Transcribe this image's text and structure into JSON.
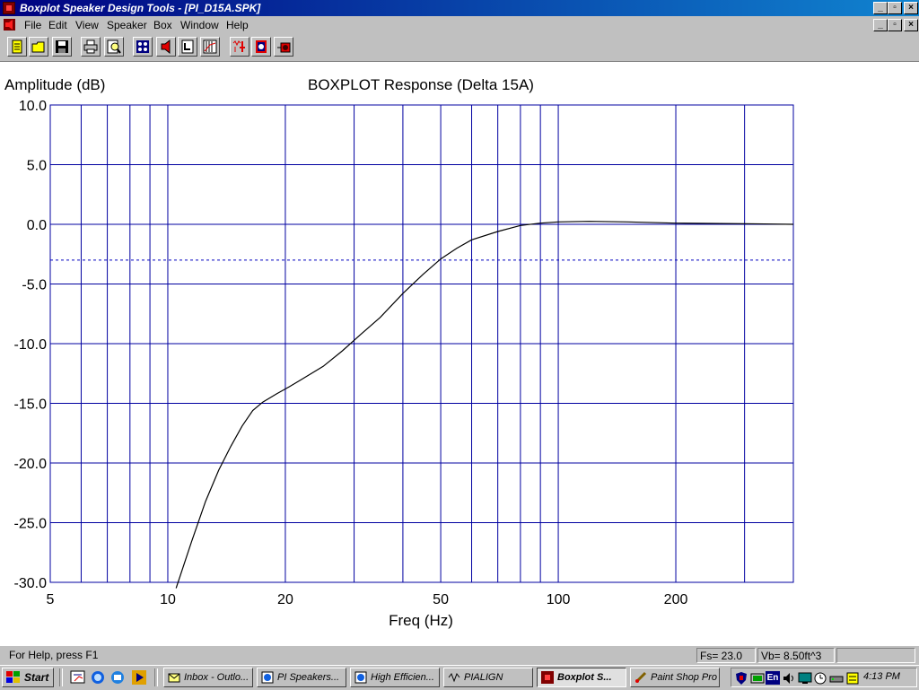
{
  "window": {
    "title": "Boxplot Speaker Design Tools - [PI_D15A.SPK]",
    "buttons": [
      "_",
      "▫",
      "×"
    ]
  },
  "menu": [
    "File",
    "Edit",
    "View",
    "Speaker",
    "Box",
    "Window",
    "Help"
  ],
  "toolbar": {
    "icons": [
      "new-file-icon",
      "open-folder-icon",
      "save-disk-icon",
      "print-icon",
      "print-preview-icon",
      "speaker-driver-icon",
      "speaker-icon",
      "box-icon",
      "chart-icon",
      "crossover-icon",
      "enclosure-icon",
      "amplifier-icon"
    ]
  },
  "chart_data": {
    "type": "line",
    "title": "BOXPLOT Response (Delta 15A)",
    "ylabel": "Amplitude (dB)",
    "xlabel": "Freq (Hz)",
    "xscale": "log",
    "xlim": [
      5,
      400
    ],
    "ylim": [
      -30,
      10
    ],
    "xticks": [
      5,
      10,
      20,
      50,
      100,
      200
    ],
    "xtick_labels": [
      "5",
      "10",
      "20",
      "50",
      "100",
      "200"
    ],
    "yticks": [
      10,
      5,
      0,
      -5,
      -10,
      -15,
      -20,
      -25,
      -30
    ],
    "ytick_labels": [
      "10.0",
      "5.0",
      "0.0",
      "-5.0",
      "-10.0",
      "-15.0",
      "-20.0",
      "-25.0",
      "-30.0"
    ],
    "reference_line_db": -3,
    "grid": true,
    "series": [
      {
        "x": [
          10.5,
          11.5,
          12.5,
          13.5,
          14.5,
          15.5,
          16.5,
          17.5,
          19,
          20.5,
          22,
          25,
          28,
          31,
          35,
          40,
          45,
          50,
          55,
          60,
          70,
          80,
          90,
          100,
          120,
          150,
          200,
          300,
          400
        ],
        "y": [
          -30.6,
          -26.6,
          -23.2,
          -20.6,
          -18.6,
          -16.9,
          -15.6,
          -14.9,
          -14.2,
          -13.6,
          -13.0,
          -11.9,
          -10.6,
          -9.3,
          -7.8,
          -5.8,
          -4.2,
          -2.9,
          -2.0,
          -1.3,
          -0.6,
          -0.1,
          0.1,
          0.2,
          0.25,
          0.2,
          0.1,
          0.05,
          0.0
        ]
      }
    ]
  },
  "status": {
    "help": "For Help, press F1",
    "fs": "Fs= 23.0",
    "vb": "Vb=  8.50ft^3",
    "blank": ""
  },
  "taskbar": {
    "start": "Start",
    "tasks": [
      "Inbox - Outlo...",
      "PI Speakers...",
      "High Efficien...",
      "PIALIGN",
      "Boxplot S...",
      "Paint Shop Pro"
    ],
    "clock": "4:13 PM",
    "lang": "En"
  }
}
